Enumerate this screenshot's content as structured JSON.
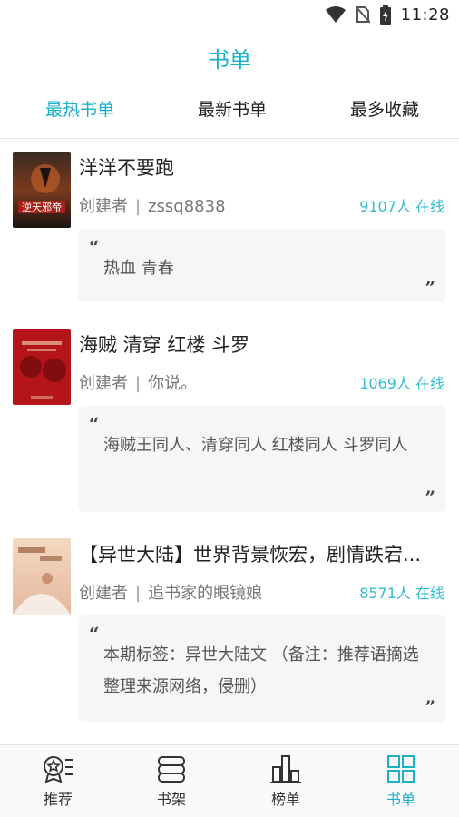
{
  "status": {
    "time": "11:28"
  },
  "header": {
    "title": "书单"
  },
  "tabs": [
    {
      "label": "最热书单",
      "active": true
    },
    {
      "label": "最新书单",
      "active": false
    },
    {
      "label": "最多收藏",
      "active": false
    }
  ],
  "items": [
    {
      "title": "洋洋不要跑",
      "creator_label": "创建者",
      "creator": "zssq8838",
      "online": "9107人 在线",
      "quote": "热血 青春",
      "cover_text": "逆天邪帝"
    },
    {
      "title": "海贼 清穿 红楼  斗罗",
      "creator_label": "创建者",
      "creator": "你说。",
      "online": "1069人 在线",
      "quote": "海贼王同人、清穿同人 红楼同人 斗罗同人"
    },
    {
      "title": "【异世大陆】世界背景恢宏，剧情跌宕...",
      "creator_label": "创建者",
      "creator": "追书家的眼镜娘",
      "online": "8571人 在线",
      "quote": "本期标签：异世大陆文 （备注：推荐语摘选整理来源网络，侵删）"
    }
  ],
  "nav": [
    {
      "label": "推荐",
      "icon": "recommend-icon",
      "active": false
    },
    {
      "label": "书架",
      "icon": "bookshelf-icon",
      "active": false
    },
    {
      "label": "榜单",
      "icon": "ranking-icon",
      "active": false
    },
    {
      "label": "书单",
      "icon": "booklist-icon",
      "active": true
    }
  ],
  "colors": {
    "accent": "#19b2c8",
    "online": "#34bcd0",
    "quote_bg": "#f6f6f6"
  }
}
